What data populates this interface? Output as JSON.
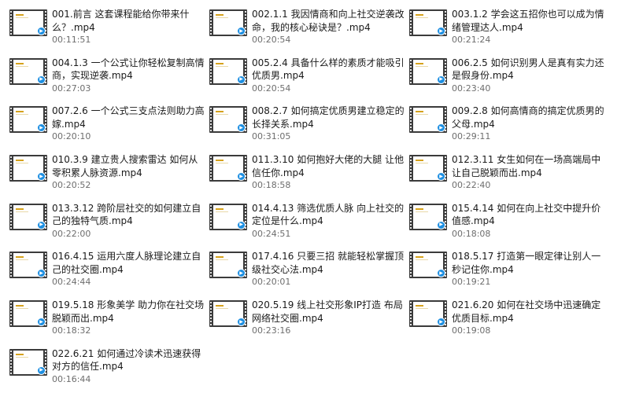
{
  "files": [
    {
      "name": "001.前言 这套课程能给你带来什么？.mp4",
      "duration": "00:11:51"
    },
    {
      "name": "002.1.1 我因情商和向上社交逆袭改命，我的核心秘诀是？.mp4",
      "duration": "00:20:54"
    },
    {
      "name": "003.1.2 学会这五招你也可以成为情绪管理达人.mp4",
      "duration": "00:21:24"
    },
    {
      "name": "004.1.3 一个公式让你轻松复制高情商，实现逆袭.mp4",
      "duration": "00:27:03"
    },
    {
      "name": "005.2.4 具备什么样的素质才能吸引优质男.mp4",
      "duration": "00:20:54"
    },
    {
      "name": "006.2.5 如何识别男人是真有实力还是假身份.mp4",
      "duration": "00:23:40"
    },
    {
      "name": "007.2.6 一个公式三支点法则助力高嫁.mp4",
      "duration": "00:20:10"
    },
    {
      "name": "008.2.7 如何搞定优质男建立稳定的长择关系.mp4",
      "duration": "00:31:05"
    },
    {
      "name": "009.2.8 如何高情商的搞定优质男的父母.mp4",
      "duration": "00:29:11"
    },
    {
      "name": "010.3.9 建立贵人搜索雷达 如何从零积累人脉资源.mp4",
      "duration": "00:20:52"
    },
    {
      "name": "011.3.10 如何抱好大佬的大腿 让他信任你.mp4",
      "duration": "00:18:58"
    },
    {
      "name": "012.3.11 女生如何在一场高端局中让自己脱颖而出.mp4",
      "duration": "00:22:40"
    },
    {
      "name": "013.3.12 跨阶层社交的如何建立自己的独特气质.mp4",
      "duration": "00:22:00"
    },
    {
      "name": "014.4.13 筛选优质人脉 向上社交的定位是什么.mp4",
      "duration": "00:24:51"
    },
    {
      "name": "015.4.14 如何在向上社交中提升价值感.mp4",
      "duration": "00:18:08"
    },
    {
      "name": "016.4.15 运用六度人脉理论建立自己的社交圈.mp4",
      "duration": "00:24:44"
    },
    {
      "name": "017.4.16 只要三招 就能轻松掌握顶级社交心法.mp4",
      "duration": "00:20:01"
    },
    {
      "name": "018.5.17 打造第一眼定律让别人一秒记住你.mp4",
      "duration": "00:19:21"
    },
    {
      "name": "019.5.18 形象美学 助力你在社交场脱颖而出.mp4",
      "duration": "00:18:32"
    },
    {
      "name": "020.5.19 线上社交形象IP打造 布局网络社交圈.mp4",
      "duration": "00:23:16"
    },
    {
      "name": "021.6.20 如何在社交场中迅速确定优质目标.mp4",
      "duration": "00:19:08"
    },
    {
      "name": "022.6.21 如何通过冷读术迅速获得对方的信任.mp4",
      "duration": "00:16:44"
    }
  ],
  "icons": {
    "file_thumbnail": "video-file-icon",
    "badge": "video-player-badge-icon",
    "badge_color": "#1e8fe1"
  }
}
